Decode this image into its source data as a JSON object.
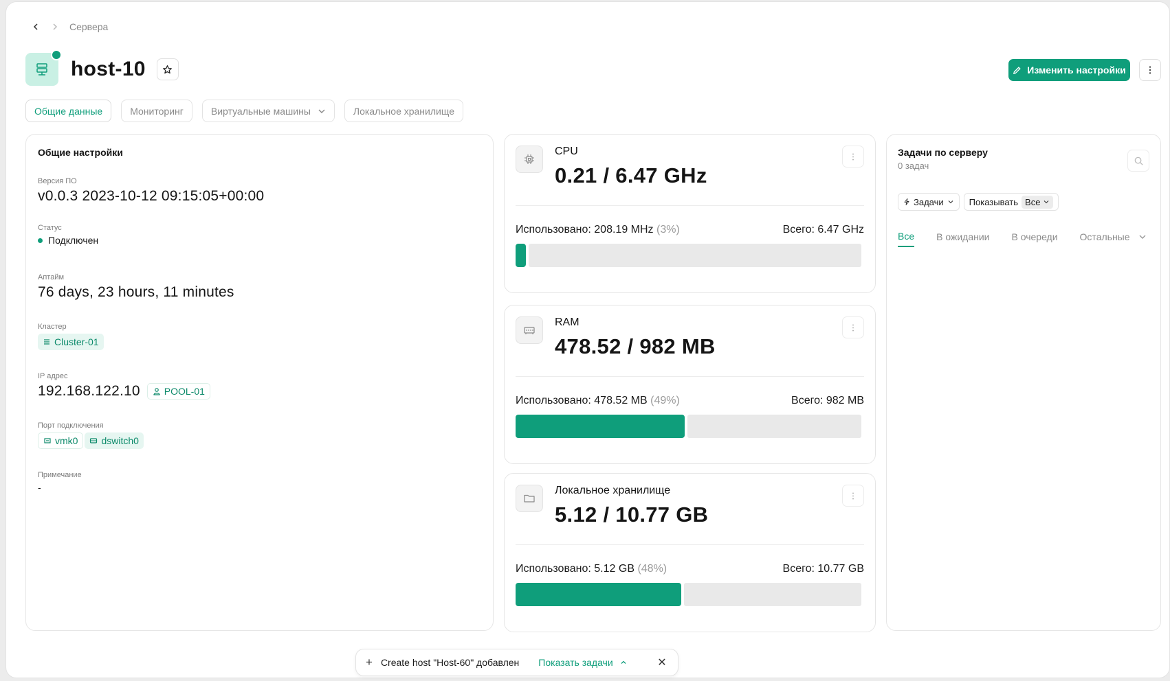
{
  "breadcrumb": {
    "current": "Сервера"
  },
  "host": {
    "name": "host-10",
    "edit_label": "Изменить настройки"
  },
  "tabs": [
    {
      "label": "Общие данные",
      "active": true
    },
    {
      "label": "Мониторинг"
    },
    {
      "label": "Виртуальные машины",
      "has_dropdown": true
    },
    {
      "label": "Локальное хранилище"
    }
  ],
  "general": {
    "title": "Общие настройки",
    "version_label": "Версия ПО",
    "version": "v0.0.3 2023-10-12 09:15:05+00:00",
    "status_label": "Статус",
    "status": "Подключен",
    "uptime_label": "Аптайм",
    "uptime": "76 days, 23 hours, 11 minutes",
    "cluster_label": "Кластер",
    "cluster": "Cluster-01",
    "ip_label": "IP адрес",
    "ip": "192.168.122.10",
    "pool": "POOL-01",
    "port_label": "Порт подключения",
    "port_vmk": "vmk0",
    "port_switch": "dswitch0",
    "note_label": "Примечание",
    "note": "-"
  },
  "resources": {
    "cpu": {
      "name": "CPU",
      "value": "0.21 / 6.47 GHz",
      "used": "Использовано: 208.19 MHz",
      "pct": "(3%)",
      "total": "Всего: 6.47 GHz",
      "fraction": 0.03
    },
    "ram": {
      "name": "RAM",
      "value": "478.52 / 982 MB",
      "used": "Использовано: 478.52 MB",
      "pct": "(49%)",
      "total": "Всего: 982 MB",
      "fraction": 0.49
    },
    "storage": {
      "name": "Локальное хранилище",
      "value": "5.12 / 10.77 GB",
      "used": "Использовано: 5.12 GB",
      "pct": "(48%)",
      "total": "Всего: 10.77 GB",
      "fraction": 0.48
    }
  },
  "tasks": {
    "title": "Задачи по серверу",
    "count": "0 задач",
    "filter_label": "Задачи",
    "show_label": "Показывать",
    "show_value": "Все",
    "subtabs": [
      "Все",
      "В ожидании",
      "В очереди",
      "Остальные"
    ]
  },
  "toast": {
    "message": "Create host \"Host-60\" добавлен",
    "link": "Показать задачи"
  },
  "colors": {
    "accent": "#0f9e7b",
    "accent_light": "#c9f0e4"
  }
}
